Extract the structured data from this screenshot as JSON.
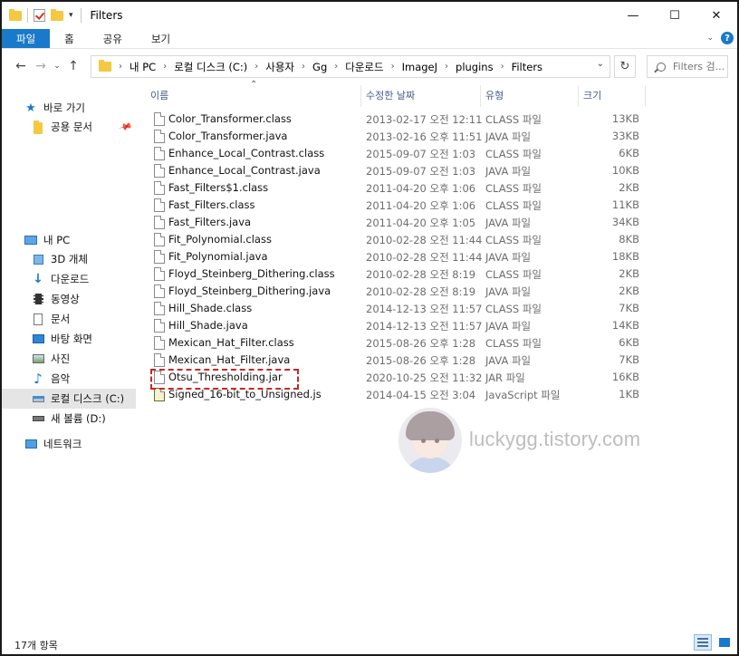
{
  "window": {
    "title": "Filters",
    "minimize_glyph": "—",
    "maximize_glyph": "☐",
    "close_glyph": "✕"
  },
  "ribbon": {
    "tabs": [
      "파일",
      "홈",
      "공유",
      "보기"
    ],
    "active_tab": "파일",
    "accent_color": "#1979ca"
  },
  "nav": {
    "back_glyph": "←",
    "forward_glyph": "→",
    "recent_glyph": "⌄",
    "up_glyph": "↑",
    "address": [
      "내 PC",
      "로컬 디스크 (C:)",
      "사용자",
      "Gg",
      "다운로드",
      "ImageJ",
      "plugins",
      "Filters"
    ],
    "refresh_glyph": "↻",
    "search_placeholder": "Filters 검..."
  },
  "sidebar": {
    "quick_access": "바로 가기",
    "pinned": "공용 문서",
    "this_pc": "내 PC",
    "items": [
      "3D 개체",
      "다운로드",
      "동영상",
      "문서",
      "바탕 화면",
      "사진",
      "음악",
      "로컬 디스크 (C:)",
      "새 볼륨 (D:)"
    ],
    "selected": "로컬 디스크 (C:)",
    "network": "네트워크"
  },
  "columns": {
    "name": "이름",
    "date": "수정한 날짜",
    "type": "유형",
    "size": "크기"
  },
  "files": [
    {
      "name": "Color_Transformer.class",
      "date": "2013-02-17 오전 12:11",
      "type": "CLASS 파일",
      "size": "13KB"
    },
    {
      "name": "Color_Transformer.java",
      "date": "2013-02-16 오후 11:51",
      "type": "JAVA 파일",
      "size": "33KB"
    },
    {
      "name": "Enhance_Local_Contrast.class",
      "date": "2015-09-07 오전 1:03",
      "type": "CLASS 파일",
      "size": "6KB"
    },
    {
      "name": "Enhance_Local_Contrast.java",
      "date": "2015-09-07 오전 1:03",
      "type": "JAVA 파일",
      "size": "10KB"
    },
    {
      "name": "Fast_Filters$1.class",
      "date": "2011-04-20 오후 1:06",
      "type": "CLASS 파일",
      "size": "2KB"
    },
    {
      "name": "Fast_Filters.class",
      "date": "2011-04-20 오후 1:06",
      "type": "CLASS 파일",
      "size": "11KB"
    },
    {
      "name": "Fast_Filters.java",
      "date": "2011-04-20 오후 1:05",
      "type": "JAVA 파일",
      "size": "34KB"
    },
    {
      "name": "Fit_Polynomial.class",
      "date": "2010-02-28 오전 11:44",
      "type": "CLASS 파일",
      "size": "8KB"
    },
    {
      "name": "Fit_Polynomial.java",
      "date": "2010-02-28 오전 11:44",
      "type": "JAVA 파일",
      "size": "18KB"
    },
    {
      "name": "Floyd_Steinberg_Dithering.class",
      "date": "2010-02-28 오전 8:19",
      "type": "CLASS 파일",
      "size": "2KB"
    },
    {
      "name": "Floyd_Steinberg_Dithering.java",
      "date": "2010-02-28 오전 8:19",
      "type": "JAVA 파일",
      "size": "2KB"
    },
    {
      "name": "Hill_Shade.class",
      "date": "2014-12-13 오전 11:57",
      "type": "CLASS 파일",
      "size": "7KB"
    },
    {
      "name": "Hill_Shade.java",
      "date": "2014-12-13 오전 11:57",
      "type": "JAVA 파일",
      "size": "14KB"
    },
    {
      "name": "Mexican_Hat_Filter.class",
      "date": "2015-08-26 오후 1:28",
      "type": "CLASS 파일",
      "size": "6KB"
    },
    {
      "name": "Mexican_Hat_Filter.java",
      "date": "2015-08-26 오후 1:28",
      "type": "JAVA 파일",
      "size": "7KB"
    },
    {
      "name": "Otsu_Thresholding.jar",
      "date": "2020-10-25 오전 11:32",
      "type": "JAR 파일",
      "size": "16KB"
    },
    {
      "name": "Signed_16-bit_to_Unsigned.js",
      "date": "2014-04-15 오전 3:04",
      "type": "JavaScript 파일",
      "size": "1KB"
    }
  ],
  "watermark": "luckygg.tistory.com",
  "status": {
    "count": "17개 항목"
  }
}
